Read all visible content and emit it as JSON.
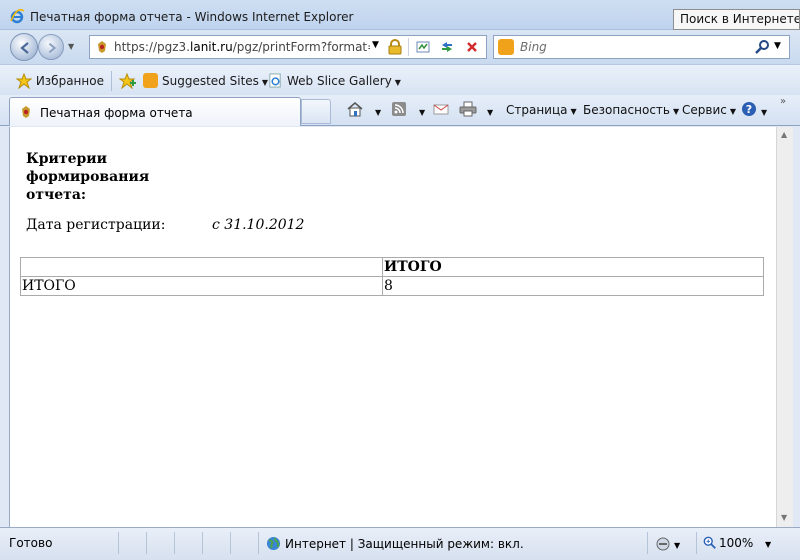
{
  "window": {
    "title": "Печатная форма отчета - Windows Internet Explorer",
    "tooltip": "Поиск в Интернете (C"
  },
  "address": {
    "url_prefix": "https://pgz3.",
    "url_domain": "lanit.ru",
    "url_path": "/pgz/printForm?format=HT"
  },
  "search": {
    "placeholder": "Bing"
  },
  "favorites": {
    "label": "Избранное",
    "suggested": "Suggested Sites",
    "webslice": "Web Slice Gallery"
  },
  "tab": {
    "label": "Печатная форма отчета"
  },
  "commands": {
    "page": "Страница",
    "safety": "Безопасность",
    "tools": "Сервис"
  },
  "report": {
    "criteria_title": "Критерии формирования отчета:",
    "reg_label": "Дата регистрации:",
    "reg_value": "с 31.10.2012",
    "table": {
      "header": [
        "",
        "ИТОГО"
      ],
      "rows": [
        [
          "ИТОГО",
          "8"
        ]
      ]
    }
  },
  "status": {
    "ready": "Готово",
    "zone": "Интернет | Защищенный режим: вкл.",
    "zoom": "100%"
  },
  "colors": {
    "accent": "#1e5fb4",
    "bing": "#f0a21b"
  }
}
